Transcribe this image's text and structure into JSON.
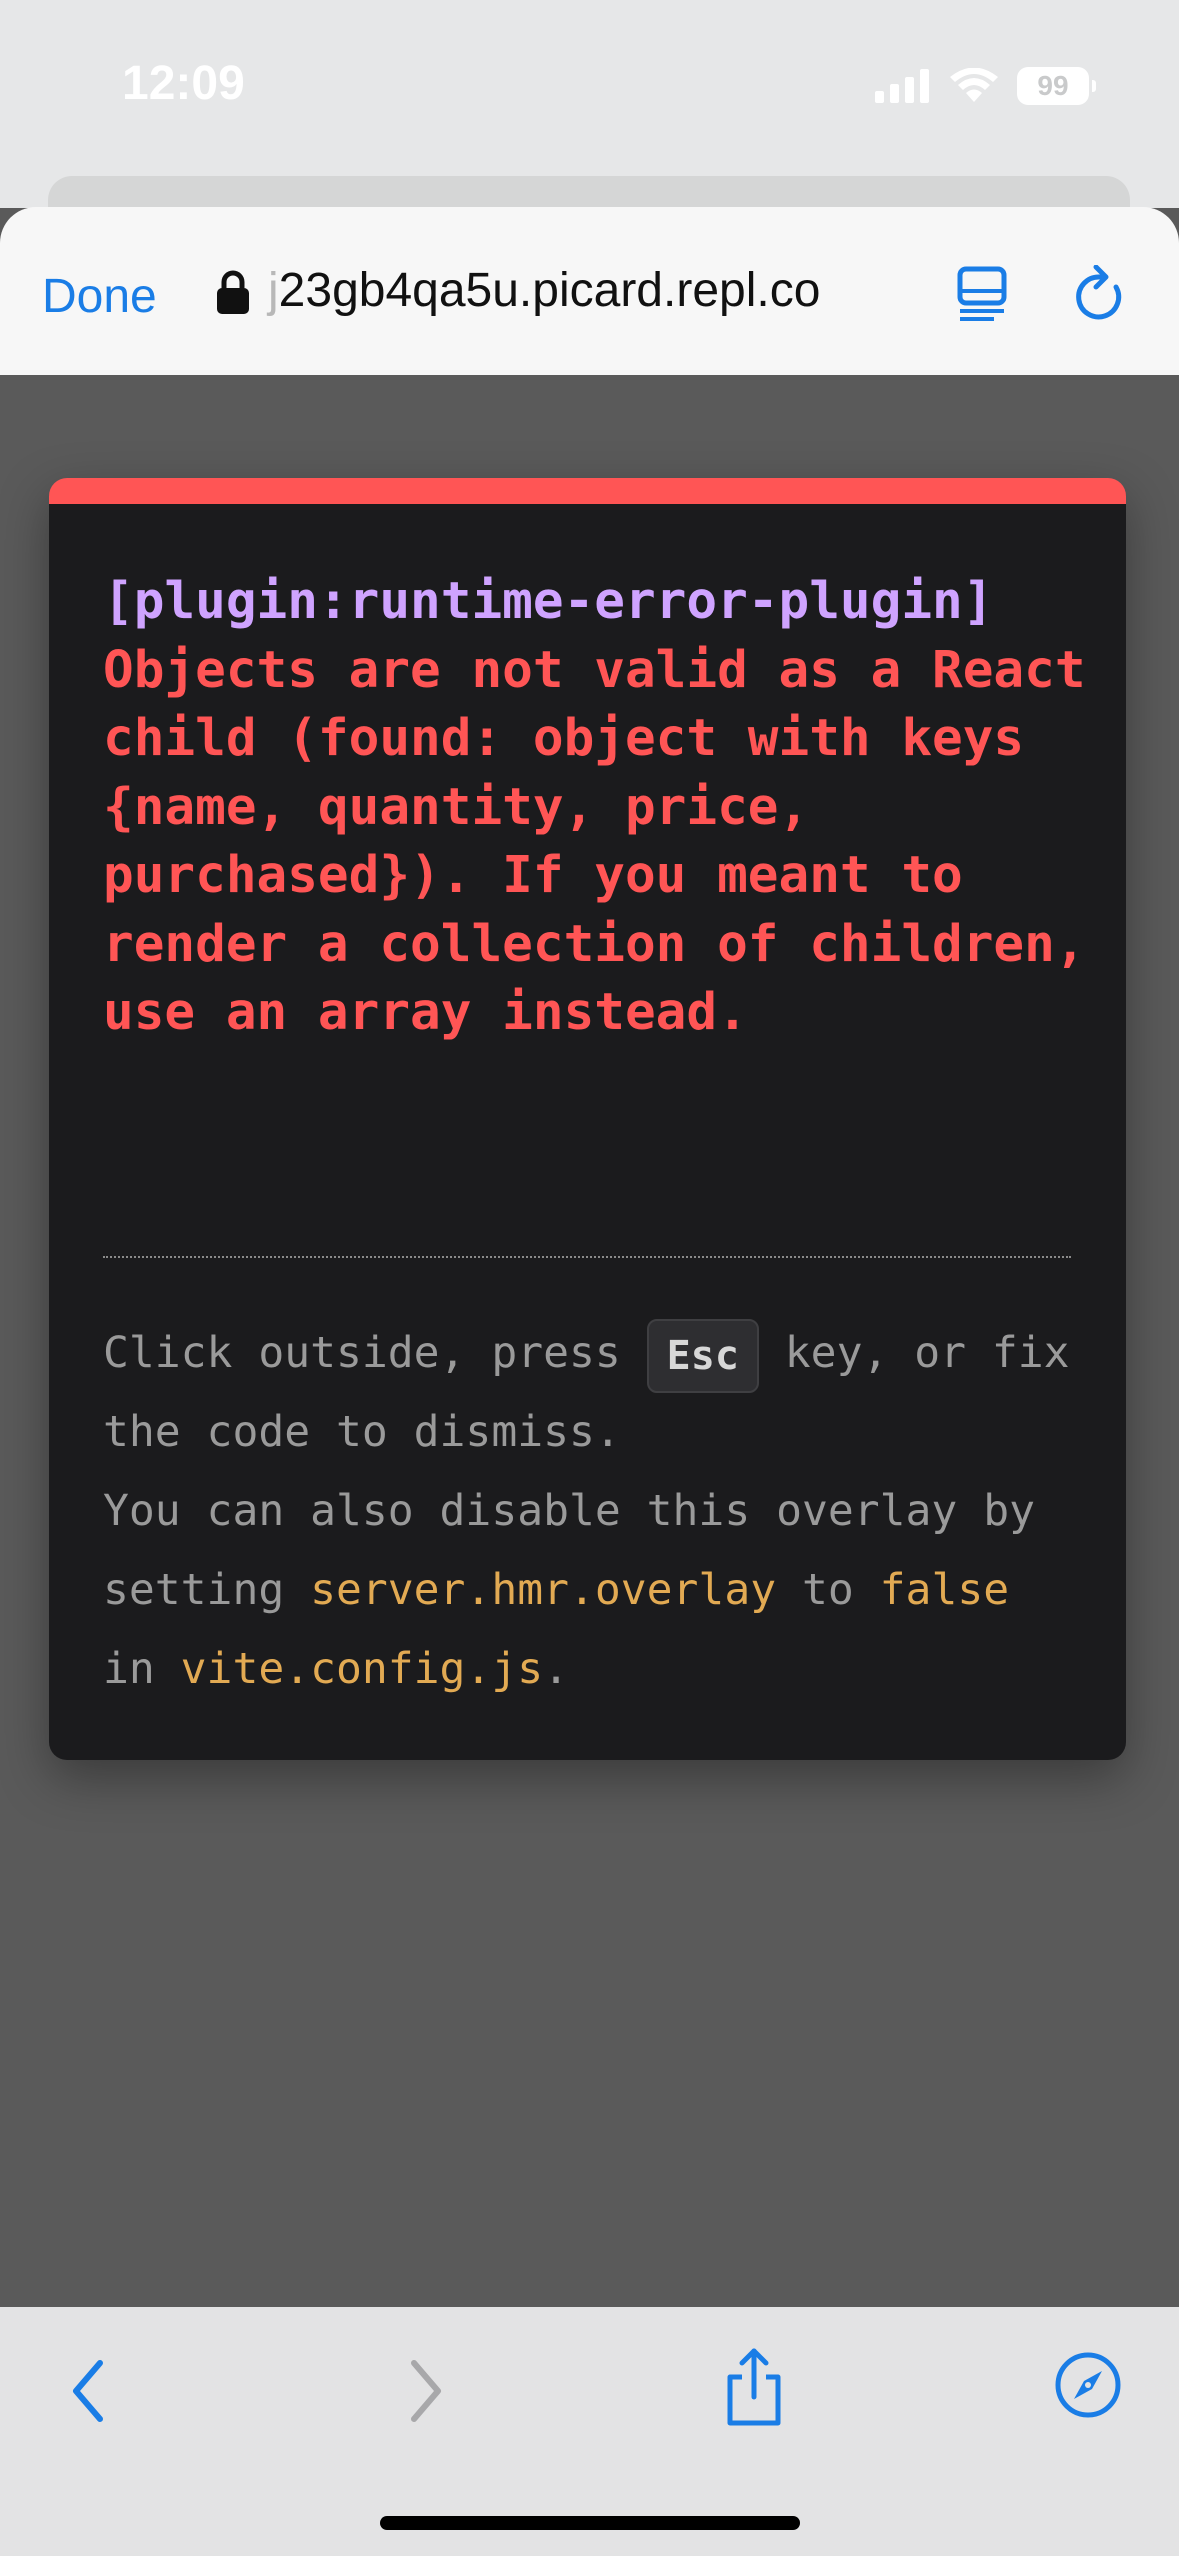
{
  "status_bar": {
    "time": "12:09",
    "battery": "99",
    "icons": [
      "signal-icon",
      "wifi-icon",
      "battery-icon"
    ]
  },
  "browser": {
    "done_label": "Done",
    "url_first_char": "j",
    "url_rest": "23gb4qa5u.picard.repl.co",
    "accent_color": "#1a7de6"
  },
  "overlay": {
    "plugin": "[plugin:runtime-error-plugin]",
    "message": "Objects are not valid as a React child (found: object with keys {name, quantity, price, purchased}). If you meant to render a collection of children, use an array instead.",
    "tip": {
      "part1": "Click outside, press ",
      "key": "Esc",
      "part2": " key, or fix the code to dismiss.",
      "part3": "You can also disable this overlay by setting ",
      "code1": "server.hmr.overlay",
      "part4": " to ",
      "code2": "false",
      "part5": "in ",
      "code3": "vite.config.js",
      "part6": "."
    },
    "colors": {
      "border": "#ff5555",
      "plugin": "#cfa3ff",
      "code": "#e2aa53"
    }
  },
  "toolbar": {
    "icons": [
      "back-icon",
      "forward-icon",
      "share-icon",
      "compass-icon"
    ]
  }
}
